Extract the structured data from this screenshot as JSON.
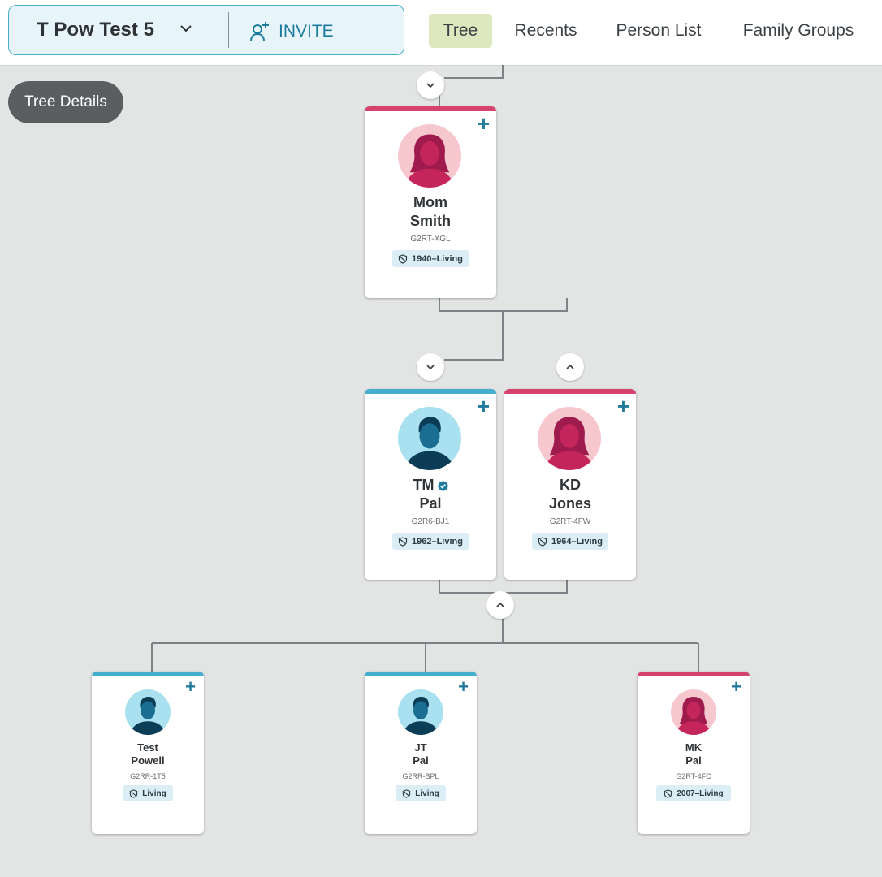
{
  "header": {
    "tree_name": "T Pow Test 5",
    "invite_label": "INVITE",
    "tabs": [
      {
        "label": "Tree",
        "active": true
      },
      {
        "label": "Recents",
        "active": false
      },
      {
        "label": "Person List",
        "active": false
      },
      {
        "label": "Family Groups",
        "active": false
      }
    ]
  },
  "tree_details_label": "Tree Details",
  "people": {
    "mom_smith": {
      "first": "Mom",
      "last": "Smith",
      "id": "G2RT-XGL",
      "lifespan": "1940–Living",
      "gender": "female"
    },
    "tm_pal": {
      "first": "TM",
      "last": "Pal",
      "id": "G2R6-BJ1",
      "lifespan": "1962–Living",
      "gender": "male",
      "verified": true
    },
    "kd_jones": {
      "first": "KD",
      "last": "Jones",
      "id": "G2RT-4FW",
      "lifespan": "1964–Living",
      "gender": "female"
    },
    "test_powell": {
      "first": "Test",
      "last": "Powell",
      "id": "G2RR-1T5",
      "lifespan": "Living",
      "gender": "male"
    },
    "jt_pal": {
      "first": "JT",
      "last": "Pal",
      "id": "G2RR-BPL",
      "lifespan": "Living",
      "gender": "male"
    },
    "mk_pal": {
      "first": "MK",
      "last": "Pal",
      "id": "G2RT-4FC",
      "lifespan": "2007–Living",
      "gender": "female"
    }
  },
  "plus_glyph": "+",
  "colors": {
    "female_accent": "#d3436d",
    "male_accent": "#46aecd",
    "brand_blue": "#1d7c9e",
    "active_tab_bg": "#dde8bf"
  },
  "icons": {
    "expand": "chevron-down-icon",
    "collapse": "chevron-up-icon",
    "invite": "add-person-icon",
    "living_status": "restricted-icon",
    "verified": "check-badge-icon"
  }
}
